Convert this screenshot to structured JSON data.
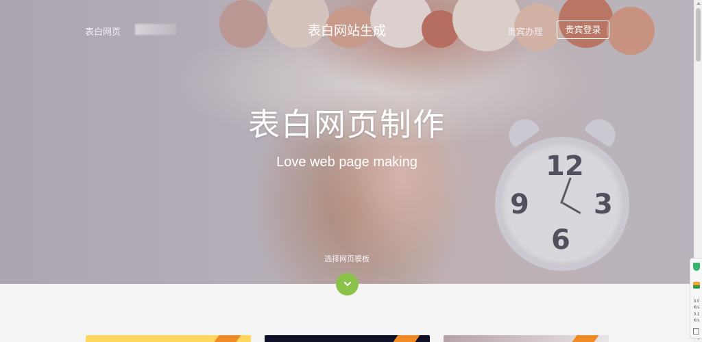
{
  "nav": {
    "home_link": "表白网页",
    "site_title": "表白网站生成",
    "vip_link": "贵宾办理",
    "login_button": "贵宾登录"
  },
  "hero": {
    "title": "表白网页制作",
    "subtitle": "Love web page making",
    "hint": "选择网页模板",
    "down_icon": "chevron-down-icon"
  },
  "clock": {
    "n12": "12",
    "n9": "9",
    "n3": "3",
    "n6": "6"
  },
  "side_widget": {
    "stat1": "0.0",
    "stat2": "K/s",
    "stat3": "0.1",
    "stat4": "K/s"
  },
  "colors": {
    "accent_green": "#8bc34a",
    "ribbon_orange": "#f08a24",
    "card1": "#ffd65e",
    "card2": "#101028",
    "card3": "#b5a2a6"
  }
}
